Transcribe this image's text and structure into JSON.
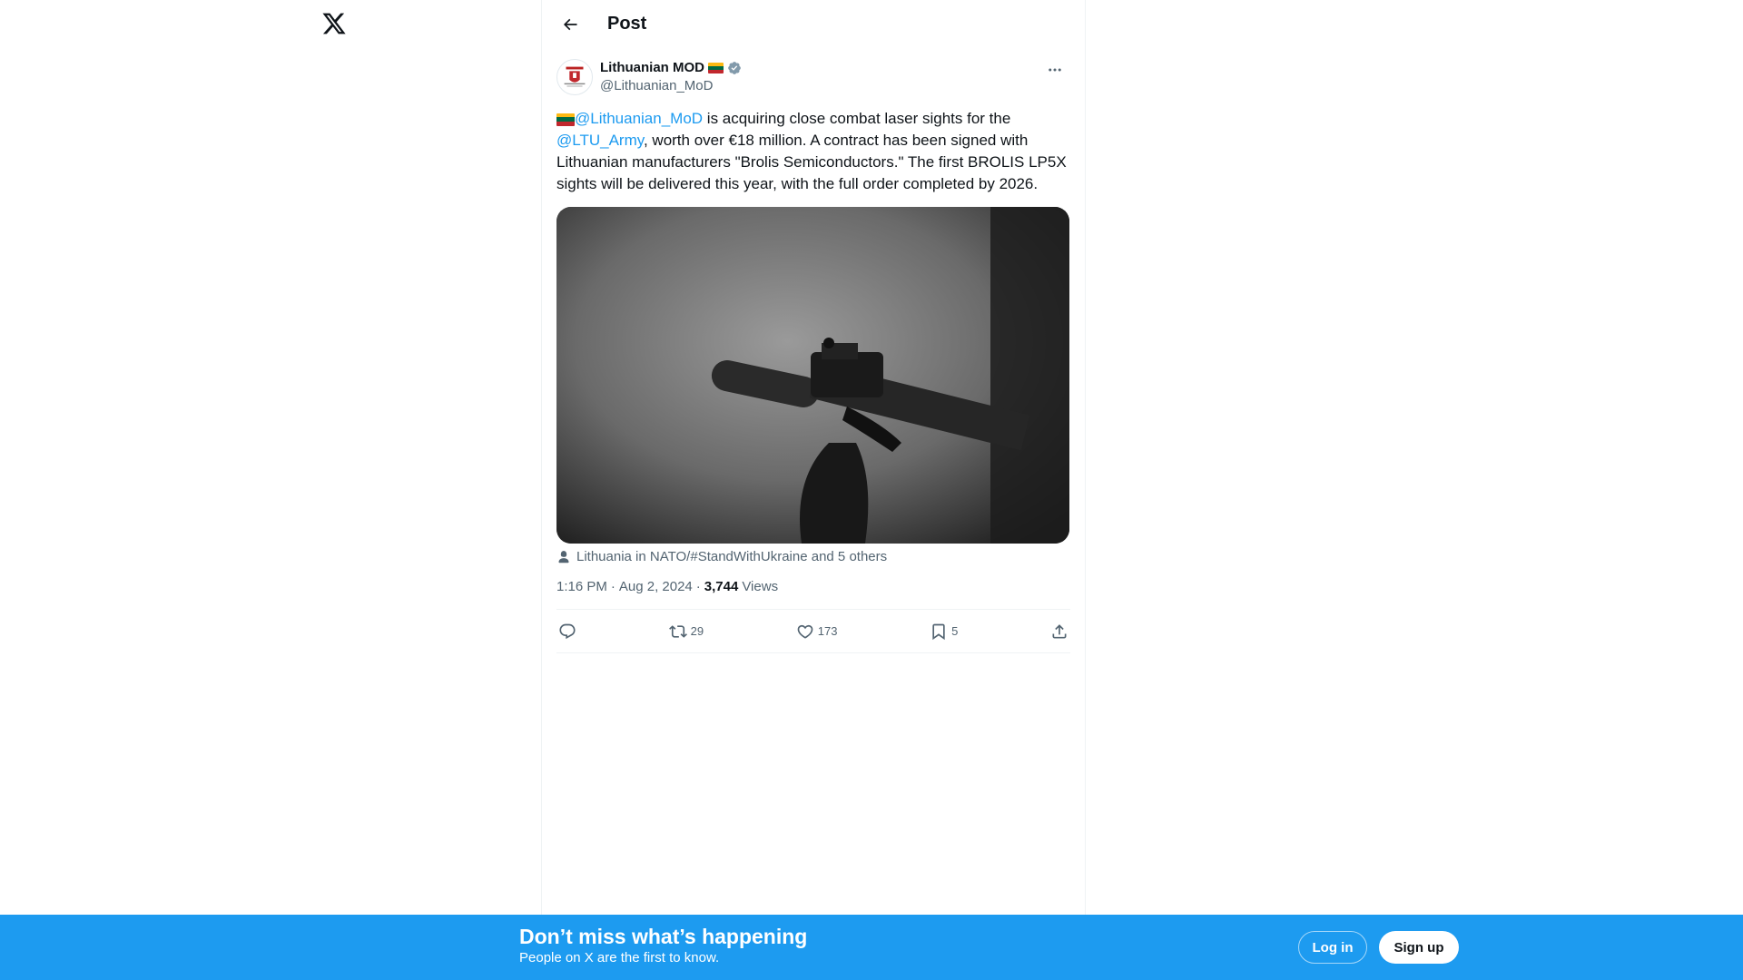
{
  "header": {
    "title": "Post"
  },
  "post": {
    "author_name": "Lithuanian MOD",
    "author_handle": "@Lithuanian_MoD",
    "text_mention_1": "@Lithuanian_MoD",
    "text_part_1": " is acquiring close combat laser sights for the ",
    "text_mention_2": "@LTU_Army",
    "text_part_2": ", worth over €18 million. A contract has been signed with Lithuanian manufacturers \"Brolis Semiconductors.\" The first BROLIS LP5X sights will be delivered this year, with the full order completed by 2026.",
    "tagged": "Lithuania in NATO/#StandWithUkraine and 5 others",
    "time": "1:16 PM",
    "date": "Aug 2, 2024",
    "views_count": "3,744",
    "views_label": "Views",
    "retweets": "29",
    "likes": "173",
    "bookmarks": "5"
  },
  "banner": {
    "title": "Don’t miss what’s happening",
    "subtitle": "People on X are the first to know.",
    "login_label": "Log in",
    "signup_label": "Sign up"
  },
  "colors": {
    "accent": "#1d9bf0",
    "text": "#0f1419",
    "secondary": "#536471"
  },
  "icons": [
    "x-logo-icon",
    "back-arrow-icon",
    "verified-icon",
    "more-icon",
    "person-icon",
    "reply-icon",
    "retweet-icon",
    "like-icon",
    "bookmark-icon",
    "share-icon"
  ]
}
